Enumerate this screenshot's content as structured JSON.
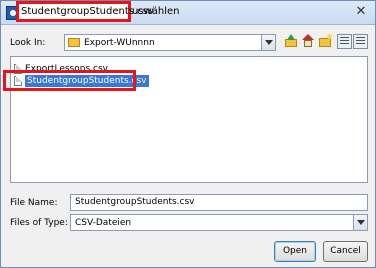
{
  "window": {
    "title_main": "StudentgroupStudents.csv",
    "title_rest": "uswählen",
    "close_glyph": "✕"
  },
  "toolbar": {
    "look_in_label": "Look In:",
    "look_in_value": "Export-WUnnnn"
  },
  "files": [
    {
      "name": "ExportLessons.csv",
      "selected": false
    },
    {
      "name": "StudentgroupStudents.csv",
      "selected": true
    }
  ],
  "form": {
    "file_name_label": "File Name:",
    "file_name_value": "StudentgroupStudents.csv",
    "files_of_type_label": "Files of Type:",
    "files_of_type_value": "CSV-Dateien"
  },
  "buttons": {
    "open": "Open",
    "cancel": "Cancel"
  },
  "colors": {
    "highlight_red": "#e8141c",
    "selection_blue": "#3a78d4"
  }
}
